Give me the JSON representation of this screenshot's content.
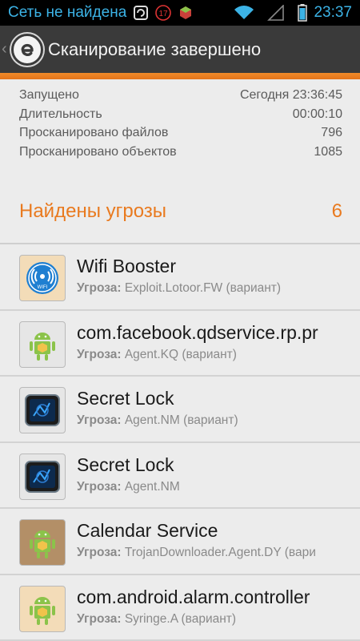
{
  "status_bar": {
    "network_text": "Сеть не найдена",
    "notification_count": "17",
    "time": "23:37"
  },
  "action_bar": {
    "title": "Сканирование завершено",
    "logo_letter": "e"
  },
  "stats": [
    {
      "label": "Запущено",
      "value": "Сегодня 23:36:45"
    },
    {
      "label": "Длительность",
      "value": "00:00:10"
    },
    {
      "label": "Просканировано файлов",
      "value": "796"
    },
    {
      "label": "Просканировано объектов",
      "value": "1085"
    }
  ],
  "threats_header": {
    "label": "Найдены угрозы",
    "count": "6"
  },
  "threat_prefix": "Угроза:",
  "threats": [
    {
      "name": "Wifi Booster",
      "threat": "Exploit.Lotoor.FW (вариант)",
      "icon": "wifi-icon",
      "icon_bg": "#f3dcb8"
    },
    {
      "name": "com.facebook.qdservice.rp.pr",
      "threat": "Agent.KQ (вариант)",
      "icon": "android-icon",
      "icon_bg": "#e6e6e6"
    },
    {
      "name": "Secret Lock",
      "threat": "Agent.NM (вариант)",
      "icon": "lock-icon",
      "icon_bg": "#e6e6e6"
    },
    {
      "name": "Secret Lock",
      "threat": "Agent.NM",
      "icon": "lock-icon",
      "icon_bg": "#e6e6e6"
    },
    {
      "name": "Calendar Service",
      "threat": "TrojanDownloader.Agent.DY (вари",
      "icon": "android-icon",
      "icon_bg": "#b38f67"
    },
    {
      "name": "com.android.alarm.controller",
      "threat": "Syringe.A (вариант)",
      "icon": "android-icon",
      "icon_bg": "#f3dcb8"
    }
  ],
  "colors": {
    "accent": "#e97a1f",
    "status_text": "#3cb3e6",
    "actionbar": "#3a3a3a"
  }
}
